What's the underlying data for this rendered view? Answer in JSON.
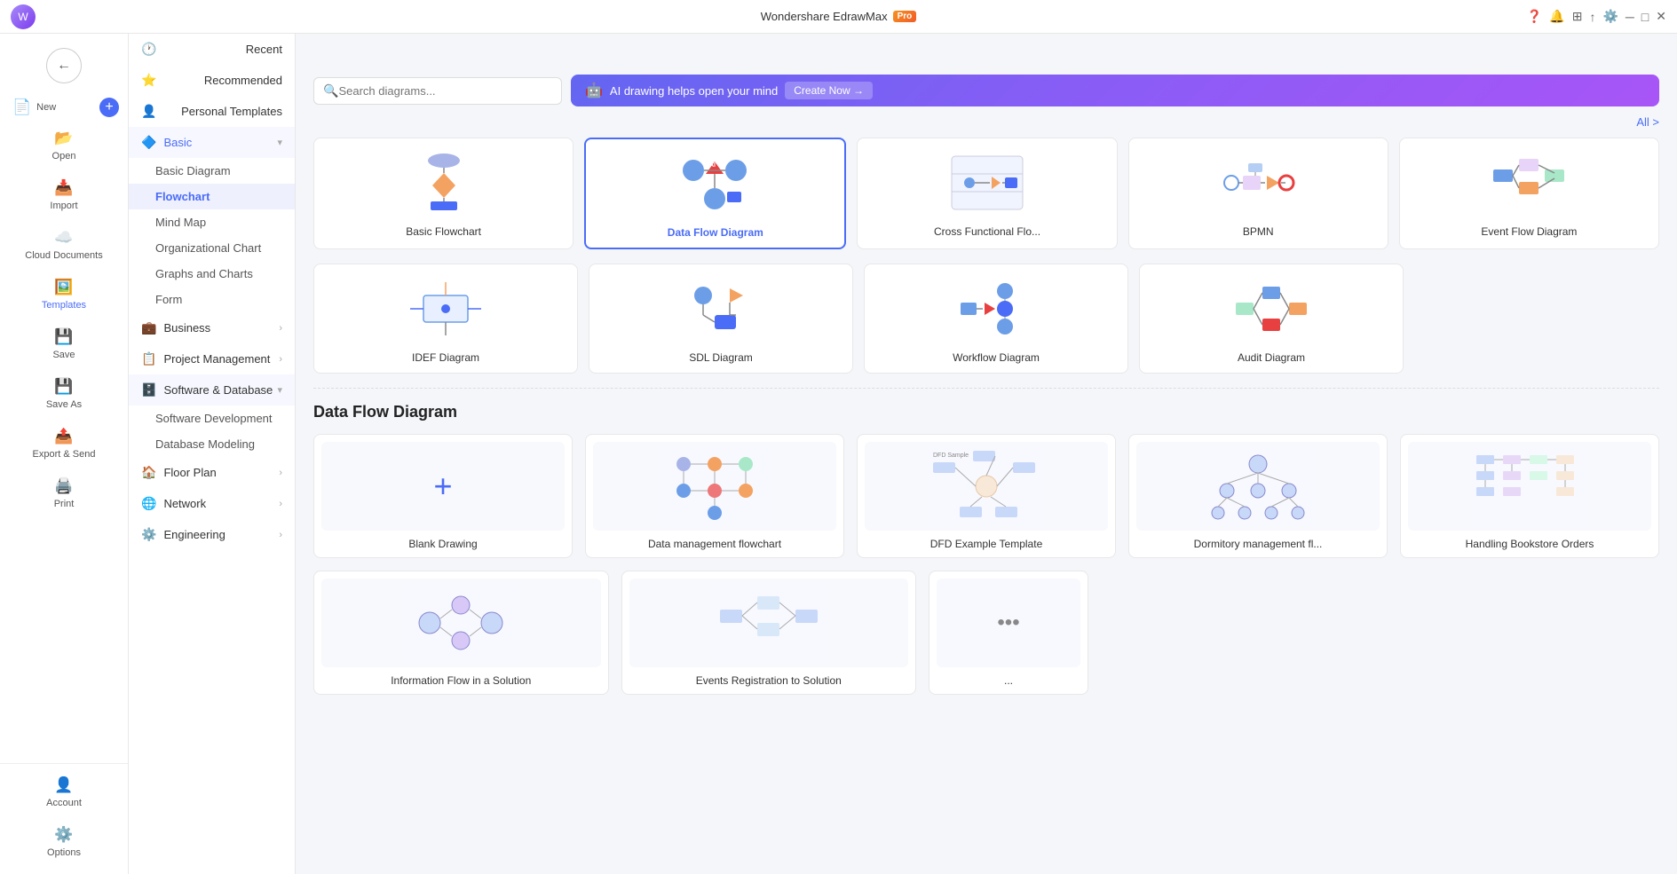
{
  "app": {
    "title": "Wondershare EdrawMax",
    "pro_badge": "Pro"
  },
  "titlebar": {
    "controls": [
      "minimize",
      "maximize",
      "close"
    ],
    "avatar_letter": "W"
  },
  "left_sidebar": {
    "items": [
      {
        "id": "new",
        "label": "New",
        "icon": "📄",
        "has_plus": true
      },
      {
        "id": "open",
        "label": "Open",
        "icon": "📂"
      },
      {
        "id": "import",
        "label": "Import",
        "icon": "📥"
      },
      {
        "id": "cloud",
        "label": "Cloud Documents",
        "icon": "☁️"
      },
      {
        "id": "templates",
        "label": "Templates",
        "icon": "🖼️",
        "active": true
      },
      {
        "id": "save",
        "label": "Save",
        "icon": "💾"
      },
      {
        "id": "saveas",
        "label": "Save As",
        "icon": "💾"
      },
      {
        "id": "export",
        "label": "Export & Send",
        "icon": "📤"
      },
      {
        "id": "print",
        "label": "Print",
        "icon": "🖨️"
      }
    ],
    "bottom_items": [
      {
        "id": "account",
        "label": "Account",
        "icon": "👤"
      },
      {
        "id": "options",
        "label": "Options",
        "icon": "⚙️"
      }
    ]
  },
  "second_sidebar": {
    "sections": [
      {
        "id": "recent",
        "label": "Recent",
        "icon": "🕐",
        "expandable": false
      },
      {
        "id": "recommended",
        "label": "Recommended",
        "icon": "⭐",
        "expandable": false
      },
      {
        "id": "personal",
        "label": "Personal Templates",
        "icon": "👤",
        "expandable": false
      },
      {
        "id": "basic",
        "label": "Basic",
        "icon": "🔷",
        "expandable": true,
        "expanded": true,
        "sub_items": [
          {
            "id": "basic_diagram",
            "label": "Basic Diagram"
          },
          {
            "id": "flowchart",
            "label": "Flowchart",
            "active": true
          },
          {
            "id": "mind_map",
            "label": "Mind Map"
          },
          {
            "id": "org_chart",
            "label": "Organizational Chart"
          },
          {
            "id": "graphs",
            "label": "Graphs and Charts"
          },
          {
            "id": "form",
            "label": "Form"
          }
        ]
      },
      {
        "id": "business",
        "label": "Business",
        "icon": "💼",
        "expandable": true
      },
      {
        "id": "project_mgmt",
        "label": "Project Management",
        "icon": "📋",
        "expandable": true
      },
      {
        "id": "software_db",
        "label": "Software & Database",
        "icon": "🗄️",
        "expandable": true,
        "expanded": true,
        "sub_items": [
          {
            "id": "software_dev",
            "label": "Software Development"
          },
          {
            "id": "db_modeling",
            "label": "Database Modeling"
          }
        ]
      },
      {
        "id": "floor_plan",
        "label": "Floor Plan",
        "icon": "🏠",
        "expandable": true
      },
      {
        "id": "network",
        "label": "Network",
        "icon": "🌐",
        "expandable": true
      },
      {
        "id": "engineering",
        "label": "Engineering",
        "icon": "⚙️",
        "expandable": true
      }
    ]
  },
  "toolbar": {
    "search_placeholder": "Search diagrams...",
    "ai_text": "AI drawing helps open your mind",
    "create_now_label": "Create Now →",
    "all_label": "All >"
  },
  "diagram_types": [
    {
      "id": "basic_flowchart",
      "label": "Basic Flowchart",
      "selected": false
    },
    {
      "id": "data_flow",
      "label": "Data Flow Diagram",
      "selected": true
    },
    {
      "id": "cross_functional",
      "label": "Cross Functional Flo...",
      "selected": false
    },
    {
      "id": "bpmn",
      "label": "BPMN",
      "selected": false
    },
    {
      "id": "event_flow",
      "label": "Event Flow Diagram",
      "selected": false
    },
    {
      "id": "idef",
      "label": "IDEF Diagram",
      "selected": false
    },
    {
      "id": "sdl",
      "label": "SDL Diagram",
      "selected": false
    },
    {
      "id": "workflow",
      "label": "Workflow Diagram",
      "selected": false
    },
    {
      "id": "audit",
      "label": "Audit Diagram",
      "selected": false
    }
  ],
  "section_title": "Data Flow Diagram",
  "templates": [
    {
      "id": "blank",
      "label": "Blank Drawing",
      "type": "blank"
    },
    {
      "id": "data_mgmt",
      "label": "Data management flowchart",
      "type": "preview"
    },
    {
      "id": "dfd_example",
      "label": "DFD Example Template",
      "type": "preview"
    },
    {
      "id": "dormitory",
      "label": "Dormitory management fl...",
      "type": "preview"
    },
    {
      "id": "bookstore",
      "label": "Handling Bookstore Orders",
      "type": "preview"
    }
  ],
  "more_templates": [
    {
      "id": "more1",
      "label": "Information Flow in a Solution",
      "type": "preview"
    },
    {
      "id": "more2",
      "label": "Events Registration to Solution",
      "type": "preview"
    },
    {
      "id": "more3",
      "label": "...",
      "type": "more"
    }
  ]
}
